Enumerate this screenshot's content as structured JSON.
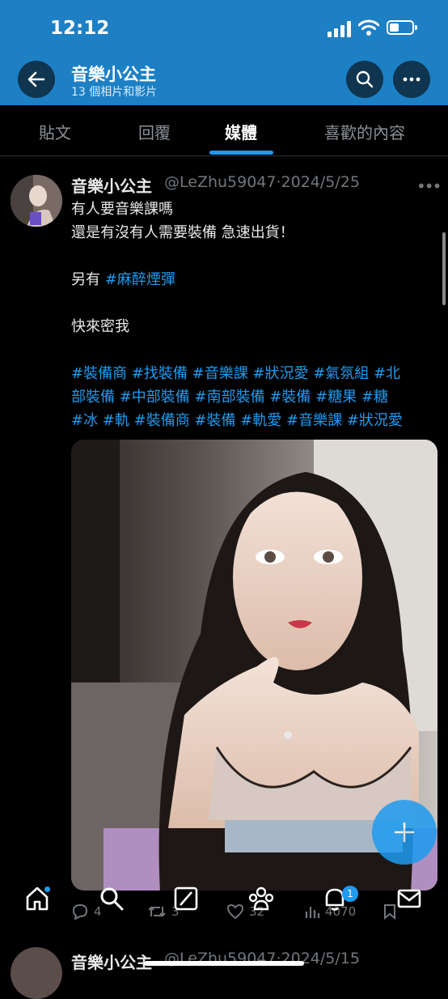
{
  "status_bar": {
    "time": "12:12"
  },
  "header": {
    "title": "音樂小公主",
    "subtitle": "13 個相片和影片",
    "back_icon": "arrow-left-icon",
    "search_icon": "search-icon",
    "more_icon": "more-horizontal-icon"
  },
  "tabs": [
    {
      "label": "貼文"
    },
    {
      "label": "回覆"
    },
    {
      "label": "媒體"
    },
    {
      "label": "喜歡的內容"
    }
  ],
  "active_tab": "媒體",
  "post": {
    "name": "音樂小公主",
    "meta": "@LeZhu59047·2024/5/25",
    "lines": [
      {
        "parts": [
          {
            "text": "有人要音樂課嗎"
          }
        ]
      },
      {
        "parts": [
          {
            "text": "還是有沒有人需要裝備 急速出貨！"
          }
        ]
      },
      {
        "parts": []
      },
      {
        "parts": [
          {
            "text": "另有 "
          },
          {
            "text": "#麻醉煙彈",
            "tag": true
          }
        ]
      },
      {
        "parts": []
      },
      {
        "parts": [
          {
            "text": "快來密我"
          }
        ]
      },
      {
        "parts": []
      },
      {
        "parts": [
          {
            "text": "#裝備商 #找裝備 #音樂課 #狀況愛 #氣氛組 #北",
            "tag": true
          }
        ]
      },
      {
        "parts": [
          {
            "text": "部裝備 #中部裝備 #南部裝備 #裝備 #糖果 #糖",
            "tag": true
          }
        ]
      },
      {
        "parts": [
          {
            "text": "#冰 #軌 #裝備商 #裝備 #軌愛 #音樂課 #狀況愛",
            "tag": true
          }
        ]
      }
    ],
    "actions": {
      "reply": "4",
      "retweet": "3",
      "like": "32",
      "views": "4070"
    }
  },
  "fab_icon": "plus-icon",
  "nav": {
    "items": [
      "home-icon",
      "search-icon",
      "grok-icon",
      "communities-icon",
      "notifications-icon",
      "messages-icon"
    ],
    "notifications_badge": "1"
  },
  "next_post": {
    "name": "音樂小公主",
    "meta": "@LeZhu59047·2024/5/15"
  },
  "colors": {
    "header_bg": "#1d7fc4",
    "accent": "#1d9bf0",
    "background": "#000000"
  }
}
